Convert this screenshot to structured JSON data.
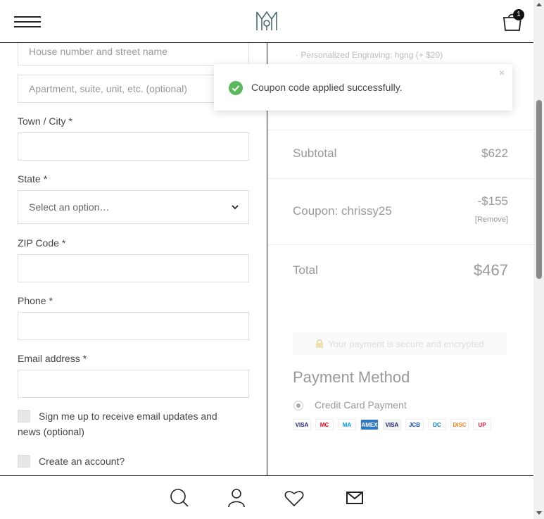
{
  "header": {
    "cart_count": "1"
  },
  "form": {
    "street_placeholder": "House number and street name",
    "apt_placeholder": "Apartment, suite, unit, etc. (optional)",
    "city_label": "Town / City",
    "state_label": "State",
    "state_value": "Select an option…",
    "zip_label": "ZIP Code",
    "phone_label": "Phone",
    "email_label": "Email address",
    "required_mark": "*",
    "newsletter_label": "Sign me up to receive email updates and news (optional)",
    "create_account_label": "Create an account?"
  },
  "summary": {
    "engraving_line": "· Personalized Engraving: hgng (+ $20)",
    "subtotal_label": "Subtotal",
    "subtotal_value": "$622",
    "coupon_label": "Coupon: chrissy25",
    "coupon_value": "-$155",
    "remove_label": "[Remove]",
    "total_label": "Total",
    "total_value": "$467",
    "secure_text": "Your payment is secure and encrypted",
    "payment_title": "Payment Method",
    "payment_option": "Credit Card Payment"
  },
  "cards": [
    {
      "name": "VISA",
      "bg": "#ffffff",
      "color": "#1a1f71"
    },
    {
      "name": "MC",
      "bg": "#ffffff",
      "color": "#eb001b"
    },
    {
      "name": "MA",
      "bg": "#ffffff",
      "color": "#0099df"
    },
    {
      "name": "AMEX",
      "bg": "#2e77bc",
      "color": "#ffffff"
    },
    {
      "name": "VISA",
      "bg": "#f4f4f4",
      "color": "#1a1f71"
    },
    {
      "name": "JCB",
      "bg": "#ffffff",
      "color": "#0b4ea2"
    },
    {
      "name": "DC",
      "bg": "#ffffff",
      "color": "#0079be"
    },
    {
      "name": "DISC",
      "bg": "#ffffff",
      "color": "#f68121"
    },
    {
      "name": "UP",
      "bg": "#ffffff",
      "color": "#e21836"
    }
  ],
  "toast": {
    "message": "Coupon code applied successfully.",
    "close": "×"
  },
  "colors": {
    "accent": "#5cb85c",
    "text": "#444444",
    "muted": "#999999"
  },
  "icons": {
    "menu": "hamburger-icon",
    "logo": "logo-mark",
    "cart": "shopping-bag-icon",
    "search": "search-icon",
    "account": "user-icon",
    "wishlist": "heart-icon",
    "contact": "mail-icon"
  }
}
